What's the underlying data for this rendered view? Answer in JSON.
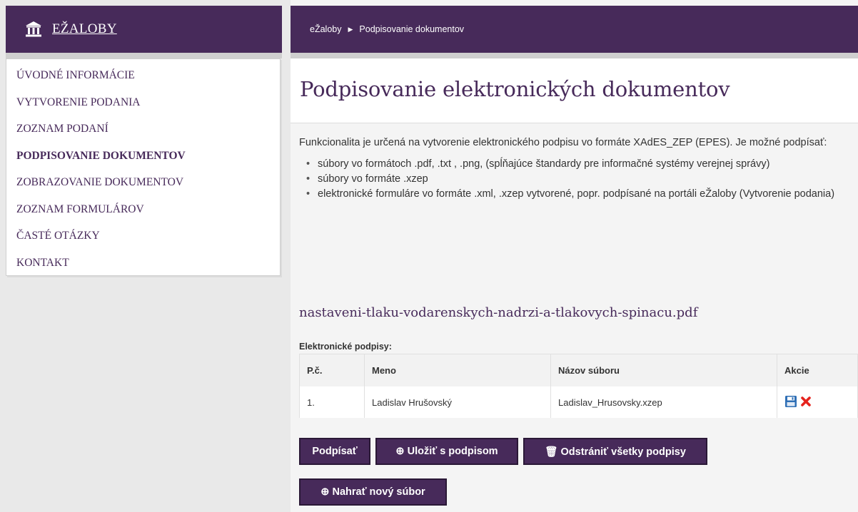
{
  "brand": {
    "title": "EŽALOBY"
  },
  "menu": {
    "items": [
      {
        "label": "ÚVODNÉ INFORMÁCIE",
        "active": false
      },
      {
        "label": "VYTVORENIE PODANIA",
        "active": false
      },
      {
        "label": "ZOZNAM PODANÍ",
        "active": false
      },
      {
        "label": "PODPISOVANIE DOKUMENTOV",
        "active": true
      },
      {
        "label": "ZOBRAZOVANIE DOKUMENTOV",
        "active": false
      },
      {
        "label": "ZOZNAM FORMULÁROV",
        "active": false
      },
      {
        "label": "ČASTÉ OTÁZKY",
        "active": false
      },
      {
        "label": "KONTAKT",
        "active": false
      }
    ]
  },
  "breadcrumb": {
    "home": "eŽaloby",
    "separator": "▶",
    "current": "Podpisovanie dokumentov"
  },
  "page": {
    "title": "Podpisovanie elektronických dokumentov",
    "intro": "Funkcionalita je určená na vytvorenie elektronického podpisu vo formáte XAdES_ZEP (EPES). Je možné podpísať:",
    "bullets": [
      "súbory vo formátoch .pdf, .txt , .png, (spĺňajúce štandardy pre informačné systémy verejnej správy)",
      "súbory vo formáte .xzep",
      "elektronické formuláre vo formáte .xml, .xzep vytvorené, popr. podpísané na portáli eŽaloby (Vytvorenie podania)"
    ],
    "filename": "nastaveni-tlaku-vodarenskych-nadrzi-a-tlakovych-spinacu.pdf",
    "signatures_label": "Elektronické podpisy:"
  },
  "table": {
    "headers": {
      "no": "P.č.",
      "name": "Meno",
      "file": "Názov súboru",
      "actions": "Akcie"
    },
    "rows": [
      {
        "no": "1.",
        "name": "Ladislav Hrušovský",
        "file": "Ladislav_Hrusovsky.xzep"
      }
    ]
  },
  "buttons": {
    "sign": "Podpísať",
    "save": "⊕ Uložiť s podpisom",
    "remove_all": "🗑 Odstrániť všetky podpisy",
    "upload": "⊕ Nahrať nový súbor"
  },
  "colors": {
    "brand": "#472a5a",
    "background": "#e9e9e9",
    "delete": "#e5231d",
    "save_icon": "#2f6fb5"
  }
}
